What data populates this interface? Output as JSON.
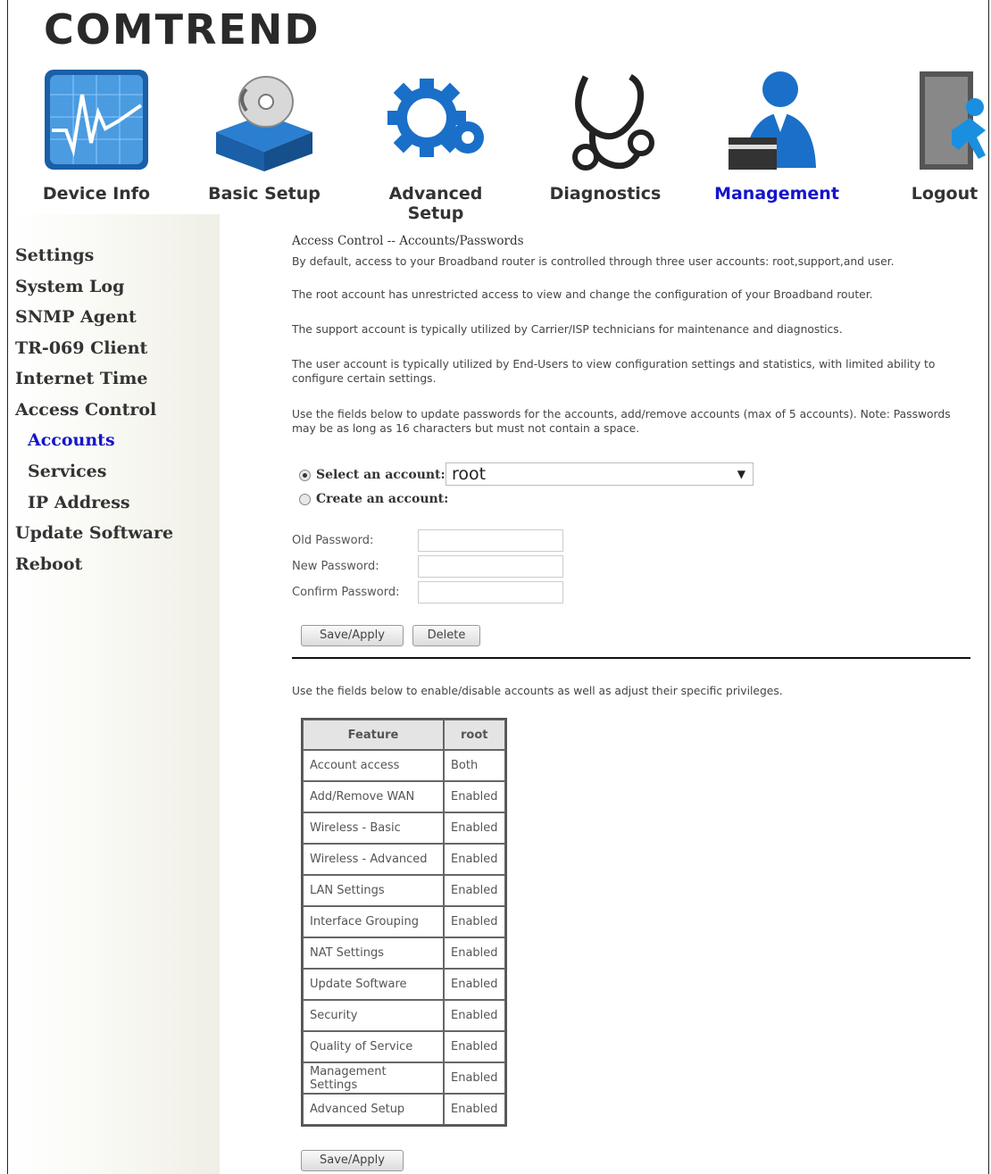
{
  "brand": "COMTREND",
  "nav": [
    {
      "label": "Device Info",
      "icon": "device-info-icon"
    },
    {
      "label": "Basic Setup",
      "icon": "basic-setup-icon"
    },
    {
      "label": "Advanced Setup",
      "icon": "advanced-setup-icon"
    },
    {
      "label": "Diagnostics",
      "icon": "diagnostics-icon"
    },
    {
      "label": "Management",
      "icon": "management-icon",
      "active": true
    },
    {
      "label": "Logout",
      "icon": "logout-icon"
    }
  ],
  "sidebar": [
    {
      "label": "Settings"
    },
    {
      "label": "System Log"
    },
    {
      "label": "SNMP Agent"
    },
    {
      "label": "TR-069 Client"
    },
    {
      "label": "Internet Time"
    },
    {
      "label": "Access Control"
    },
    {
      "label": "Accounts",
      "active": true
    },
    {
      "label": "Services"
    },
    {
      "label": "IP Address"
    },
    {
      "label": "Update Software"
    },
    {
      "label": "Reboot"
    }
  ],
  "page": {
    "title": "Access Control -- Accounts/Passwords",
    "intro": "By default, access to your Broadband router is controlled through three user accounts: root,support,and user.",
    "root_desc": "The root account has unrestricted access to view and change the configuration of your Broadband router.",
    "support_desc": "The support account is typically utilized by Carrier/ISP technicians for maintenance and diagnostics.",
    "user_desc": "The user account is typically utilized by End-Users to view configuration settings and statistics, with limited ability to configure certain settings.",
    "instructions": "Use the fields below to update passwords for the accounts, add/remove accounts (max of 5 accounts). Note: Passwords may be as long as 16 characters but must not contain a space.",
    "select_label": "Select an account:",
    "selected_account": "root",
    "create_label": "Create an account:",
    "old_password_label": "Old Password:",
    "new_password_label": "New Password:",
    "confirm_password_label": "Confirm Password:",
    "save_apply": "Save/Apply",
    "delete": "Delete",
    "privileges_text": "Use the fields below to enable/disable accounts as well as adjust their specific privileges.",
    "bottom_save_apply": "Save/Apply"
  },
  "table": {
    "headers": [
      "Feature",
      "root"
    ],
    "rows": [
      [
        "Account access",
        "Both"
      ],
      [
        "Add/Remove WAN",
        "Enabled"
      ],
      [
        "Wireless - Basic",
        "Enabled"
      ],
      [
        "Wireless - Advanced",
        "Enabled"
      ],
      [
        "LAN Settings",
        "Enabled"
      ],
      [
        "Interface Grouping",
        "Enabled"
      ],
      [
        "NAT Settings",
        "Enabled"
      ],
      [
        "Update Software",
        "Enabled"
      ],
      [
        "Security",
        "Enabled"
      ],
      [
        "Quality of Service",
        "Enabled"
      ],
      [
        "Management Settings",
        "Enabled"
      ],
      [
        "Advanced Setup",
        "Enabled"
      ]
    ]
  },
  "colors": {
    "active_link": "#1414cc",
    "text": "#333333"
  }
}
